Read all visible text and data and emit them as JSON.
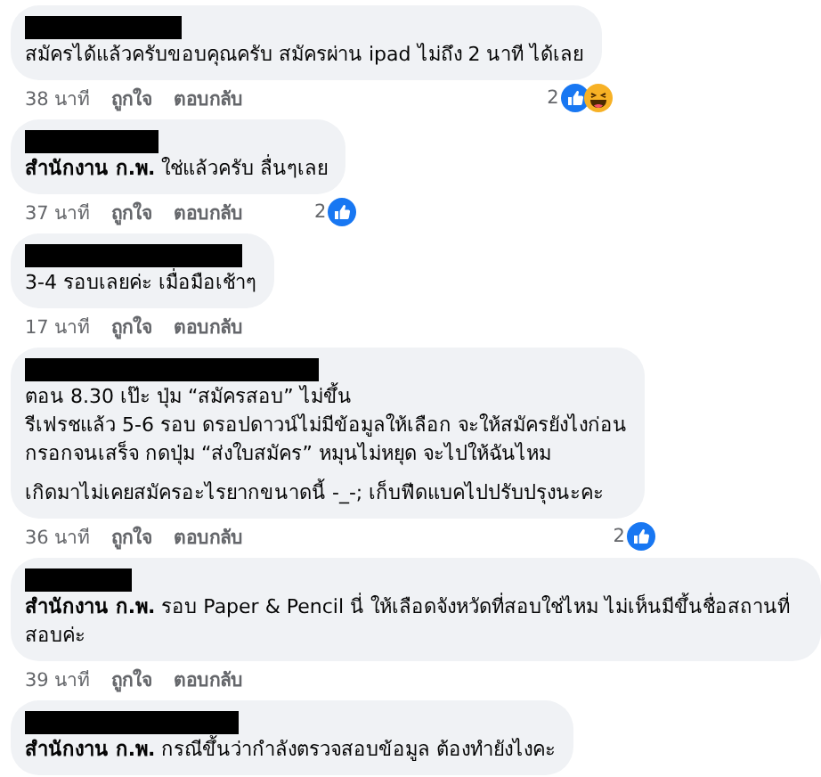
{
  "comments": [
    {
      "lines": [
        "สมัครได้แล้วครับขอบคุณครับ สมัครผ่าน ipad ไม่ถึง 2 นาที ได้เลย"
      ],
      "time": "38 นาที",
      "like": "ถูกใจ",
      "reply": "ตอบกลับ",
      "reactions": {
        "count": "2",
        "icons": [
          {
            "kind": "like"
          },
          {
            "kind": "haha"
          }
        ]
      }
    },
    {
      "lines": [
        "**สำนักงาน ก.พ.** ใช่แล้วครับ ลื่นๆเลย"
      ],
      "time": "37 นาที",
      "like": "ถูกใจ",
      "reply": "ตอบกลับ",
      "reactions": {
        "count": "2",
        "icons": [
          {
            "kind": "like"
          }
        ]
      }
    },
    {
      "lines": [
        "3-4 รอบเลยค่ะ เมื่อมือเช้าๆ"
      ],
      "time": "17 นาที",
      "like": "ถูกใจ",
      "reply": "ตอบกลับ"
    },
    {
      "lines": [
        "ตอน 8.30 เป๊ะ ปุ่ม “สมัครสอบ” ไม่ขึ้น\nรีเฟรชแล้ว 5-6 รอบ ดรอปดาวน์ไม่มีข้อมูลให้เลือก จะให้สมัครยังไงก่อน\nกรอกจนเสร็จ กดปุ่ม “ส่งใบสมัคร” หมุนไม่หยุด จะไปให้ฉันไหม",
        "เกิดมาไม่เคยสมัครอะไรยากขนาดนี้ -_-; เก็บฟีดแบคไปปรับปรุงนะคะ"
      ],
      "time": "36 นาที",
      "like": "ถูกใจ",
      "reply": "ตอบกลับ",
      "reactions": {
        "count": "2",
        "icons": [
          {
            "kind": "like"
          }
        ]
      }
    },
    {
      "lines": [
        "**สำนักงาน ก.พ.** รอบ Paper & Pencil นี่ ให้เลือดจังหวัดที่สอบใช่ไหม ไม่เห็นมีขึ้นชื่อสถานที่สอบค่ะ"
      ],
      "time": "39 นาที",
      "like": "ถูกใจ",
      "reply": "ตอบกลับ"
    },
    {
      "lines": [
        "**สำนักงาน ก.พ.** กรณีขึ้นว่ากำลังตรวจสอบข้อมูล ต้องทำยังไงคะ"
      ]
    }
  ]
}
